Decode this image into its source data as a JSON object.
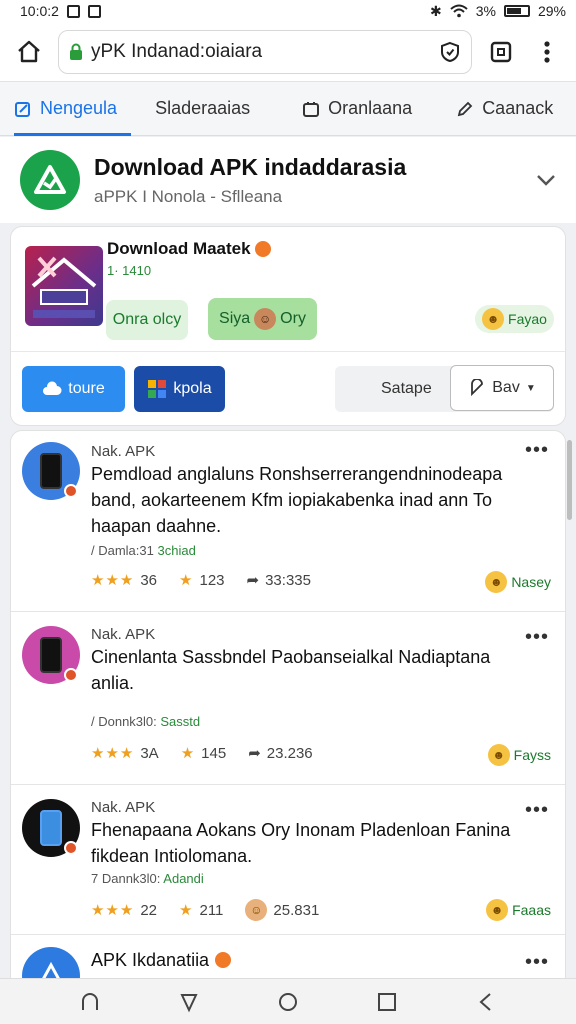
{
  "status_bar": {
    "time": "10:0:2",
    "battery": "29%",
    "signal": "3%"
  },
  "browser": {
    "url": "yPK Indanad:oiaiara"
  },
  "tabs": [
    {
      "label": "Nengeula",
      "icon": "edit-icon"
    },
    {
      "label": "Sladeraaias"
    },
    {
      "label": "Oranlaana",
      "icon": "calendar-icon"
    },
    {
      "label": "Caanack",
      "icon": "pen-icon"
    }
  ],
  "header": {
    "title": "Download APK indaddarasia",
    "subtitle": "aPPK I Nonola - Sflleana"
  },
  "feature": {
    "title": "Download Maatek",
    "count": "1· 1410",
    "chip_a": "Onra olcy",
    "chip_b_left": "Siya",
    "chip_b_right": "Ory",
    "chip_c": "Fayao",
    "btn_1": "toure",
    "btn_2": "kpola",
    "btn_3": "Satape",
    "btn_4": "Bav"
  },
  "items": [
    {
      "source": "Nak. APK",
      "description": "Pemdload anglaluns Ronshserrerangendninodeapa band, aokarteenem Kfm iopiakabenka inad ann To haapan daahne.",
      "meta_left": "/ Damla:31",
      "meta_right": "3chiad",
      "stars": "★★★",
      "rating": "36",
      "saves": "123",
      "shares": "33:335",
      "reaction": "Nasey",
      "avatar_color": "#3a7ee0"
    },
    {
      "source": "Nak. APK",
      "description": "Cinenlanta Sassbndel Paobanseialkal Nadiaptana anlia.",
      "meta_left": "/ Donnk3l0:",
      "meta_right": "Sasstd",
      "stars": "★★★",
      "rating": "3A",
      "saves": "145",
      "shares": "23.236",
      "reaction": "Fayss",
      "avatar_color": "#c94aa8"
    },
    {
      "source": "Nak. APK",
      "description": "Fhenapaana Aokans Ory Inonam Pladenloan Fanina fikdean Intiolomana.",
      "meta_left": "7 Dannk3l0:",
      "meta_right": "Adandi",
      "stars": "★★★",
      "rating": "22",
      "saves": "211",
      "shares": "25.831",
      "reaction": "Faaas",
      "avatar_color": "#111111"
    },
    {
      "source": "",
      "description": "APK Ikdanatiia",
      "meta_left": "",
      "meta_right": "",
      "avatar_color": "#2d7be0"
    }
  ],
  "colors": {
    "accent": "#1a73e8",
    "brand_green": "#1aa34a",
    "star": "#f0a020"
  }
}
